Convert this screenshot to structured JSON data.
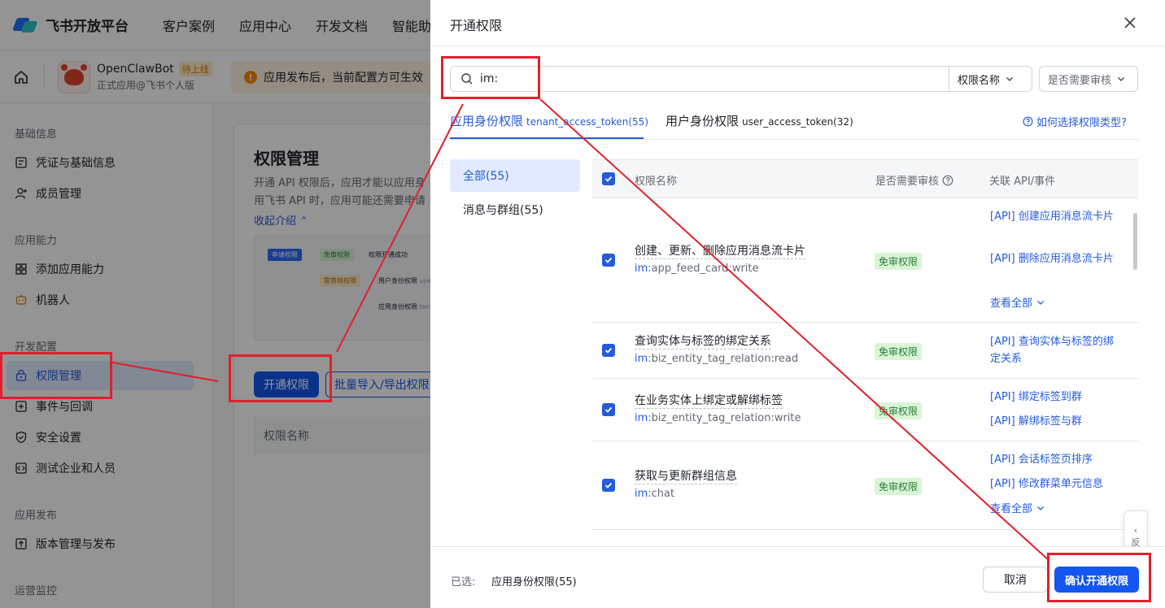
{
  "topnav": {
    "logo_text": "飞书开放平台",
    "items": [
      "客户案例",
      "应用中心",
      "开发文档",
      "智能助手"
    ]
  },
  "appbar": {
    "app_name": "OpenClawBot",
    "status_badge": "待上线",
    "app_sub": "正式应用@飞书个人版",
    "notice": "应用发布后，当前配置方可生效"
  },
  "sidebar": {
    "groups": [
      "基础信息",
      "应用能力",
      "开发配置",
      "应用发布",
      "运营监控"
    ],
    "items": [
      {
        "label": "凭证与基础信息",
        "icon": "credential-icon"
      },
      {
        "label": "成员管理",
        "icon": "member-icon"
      },
      {
        "label": "添加应用能力",
        "icon": "grid-icon"
      },
      {
        "label": "机器人",
        "icon": "robot-icon"
      },
      {
        "label": "权限管理",
        "icon": "lock-icon",
        "active": true
      },
      {
        "label": "事件与回调",
        "icon": "event-icon"
      },
      {
        "label": "安全设置",
        "icon": "shield-icon"
      },
      {
        "label": "测试企业和人员",
        "icon": "code-icon"
      },
      {
        "label": "版本管理与发布",
        "icon": "upload-icon"
      }
    ]
  },
  "page": {
    "title": "权限管理",
    "desc_line1": "开通 API 权限后，应用才能以应用身",
    "desc_line2": "用飞书 API 时，应用可能还需要申请",
    "collapse": "收起介绍",
    "flow": {
      "apply": "申请权限",
      "free": "免审权限",
      "review": "需审核权限",
      "success": "权限开通成功",
      "user": "用户身份权限",
      "user_token": "user",
      "tenant": "应用身份权限",
      "tenant_token": "tena"
    },
    "btn_open": "开通权限",
    "btn_batch": "批量导入/导出权限",
    "table_header": "权限名称"
  },
  "drawer": {
    "title": "开通权限",
    "search_value": "im:",
    "search_select": "权限名称",
    "review_select": "是否需要审核",
    "tabs": [
      {
        "label": "应用身份权限",
        "token": "tenant_access_token(55)",
        "active": true
      },
      {
        "label": "用户身份权限",
        "token": "user_access_token(32)",
        "active": false
      }
    ],
    "help_link": "如何选择权限类型?",
    "categories": [
      {
        "label": "全部(55)",
        "active": true
      },
      {
        "label": "消息与群组(55)",
        "active": false
      }
    ],
    "table": {
      "col_name": "权限名称",
      "col_review": "是否需要审核",
      "col_api": "关联 API/事件",
      "rows": [
        {
          "name": "创建、更新、删除应用消息流卡片",
          "code_prefix": "im",
          "code_rest": ":app_feed_card:write",
          "review": "免审权限",
          "apis": [
            "[API] 创建应用消息流卡片",
            "[API] 删除应用消息流卡片"
          ],
          "more": "查看全部"
        },
        {
          "name": "查询实体与标签的绑定关系",
          "code_prefix": "im",
          "code_rest": ":biz_entity_tag_relation:read",
          "review": "免审权限",
          "apis": [
            "[API] 查询实体与标签的绑定关系"
          ]
        },
        {
          "name": "在业务实体上绑定或解绑标签",
          "code_prefix": "im",
          "code_rest": ":biz_entity_tag_relation:write",
          "review": "免审权限",
          "apis": [
            "[API] 绑定标签到群",
            "[API] 解绑标签与群"
          ]
        },
        {
          "name": "获取与更新群组信息",
          "code_prefix": "im",
          "code_rest": ":chat",
          "review": "免审权限",
          "apis": [
            "[API] 会话标签页排序",
            "[API] 修改群菜单元信息"
          ],
          "more": "查看全部"
        }
      ]
    },
    "side_fab": "反",
    "footer": {
      "selected_label": "已选:",
      "selected_value": "应用身份权限(55)",
      "cancel": "取消",
      "confirm": "确认开通权限"
    }
  },
  "colors": {
    "primary": "#1456f0",
    "link": "#245bdb",
    "annotation_red": "#e0202a",
    "free_tag_bg": "#d9f5d6"
  }
}
